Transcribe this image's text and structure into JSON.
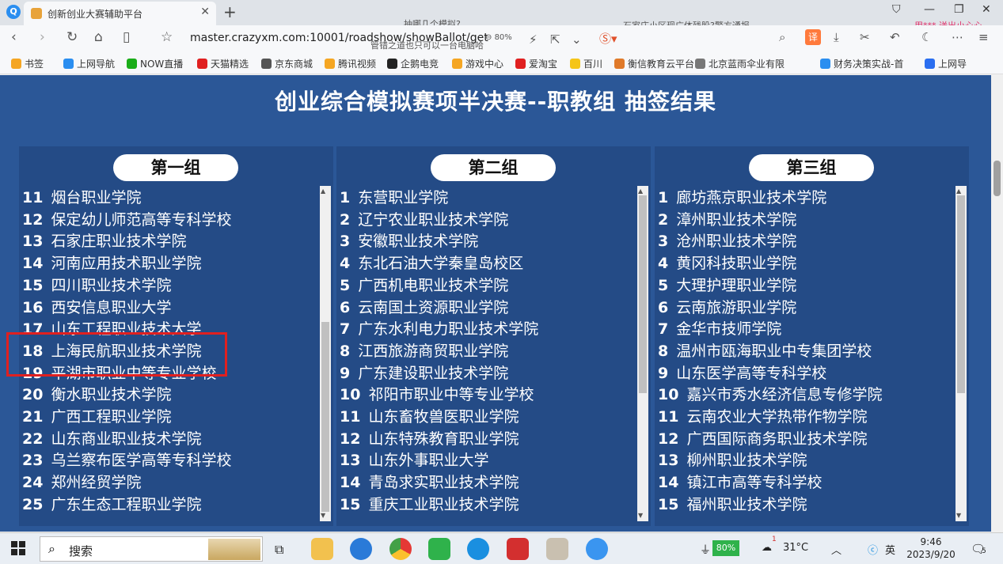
{
  "browser": {
    "tab_title": "创新创业大赛辅助平台",
    "url": "master.crazyxm.com:10001/roadshow/showBallot/get",
    "zoom": "80%",
    "promo": "用*** 送出小心心",
    "overlay_1": "抽哪几个模拟?",
    "overlay_2": "管错之道也只可以一台电脑哈",
    "overlay_3": "石家庄小区现广体残股?警方通报"
  },
  "bookmarks": [
    {
      "label": "书签",
      "color": "#f5a623"
    },
    {
      "label": "上网导航",
      "color": "#2a8ef0"
    },
    {
      "label": "NOW直播",
      "color": "#1aad19"
    },
    {
      "label": "天猫精选",
      "color": "#e02020"
    },
    {
      "label": "京东商城",
      "color": "#555555"
    },
    {
      "label": "腾讯视频",
      "color": "#f5a623"
    },
    {
      "label": "企鹅电竞",
      "color": "#222222"
    },
    {
      "label": "游戏中心",
      "color": "#f5a623"
    },
    {
      "label": "爱淘宝",
      "color": "#e02020"
    },
    {
      "label": "百川",
      "color": "#f5c518"
    },
    {
      "label": "衡信教育云平台",
      "color": "#e07a2a"
    },
    {
      "label": "北京蓝雨伞业有限",
      "color": "#777777"
    },
    {
      "label": "财务决策实战-首",
      "color": "#2a8ef0"
    },
    {
      "label": "上网导",
      "color": "#2a6ef0"
    }
  ],
  "page": {
    "title": "创业综合模拟赛项半决赛--职教组 抽签结果",
    "groups": [
      {
        "name": "第一组",
        "items": [
          {
            "num": "11",
            "name": "烟台职业学院"
          },
          {
            "num": "12",
            "name": "保定幼儿师范高等专科学校"
          },
          {
            "num": "13",
            "name": "石家庄职业技术学院"
          },
          {
            "num": "14",
            "name": "河南应用技术职业学院"
          },
          {
            "num": "15",
            "name": "四川职业技术学院"
          },
          {
            "num": "16",
            "name": "西安信息职业大学"
          },
          {
            "num": "17",
            "name": "山东工程职业技术大学"
          },
          {
            "num": "18",
            "name": "上海民航职业技术学院"
          },
          {
            "num": "19",
            "name": "平湖市职业中等专业学校"
          },
          {
            "num": "20",
            "name": "衡水职业技术学院"
          },
          {
            "num": "21",
            "name": "广西工程职业学院"
          },
          {
            "num": "22",
            "name": "山东商业职业技术学院"
          },
          {
            "num": "23",
            "name": "乌兰察布医学高等专科学校"
          },
          {
            "num": "24",
            "name": "郑州经贸学院"
          },
          {
            "num": "25",
            "name": "广东生态工程职业学院"
          }
        ]
      },
      {
        "name": "第二组",
        "items": [
          {
            "num": "1",
            "name": "东营职业学院"
          },
          {
            "num": "2",
            "name": "辽宁农业职业技术学院"
          },
          {
            "num": "3",
            "name": "安徽职业技术学院"
          },
          {
            "num": "4",
            "name": "东北石油大学秦皇岛校区"
          },
          {
            "num": "5",
            "name": "广西机电职业技术学院"
          },
          {
            "num": "6",
            "name": "云南国土资源职业学院"
          },
          {
            "num": "7",
            "name": "广东水利电力职业技术学院"
          },
          {
            "num": "8",
            "name": "江西旅游商贸职业学院"
          },
          {
            "num": "9",
            "name": "广东建设职业技术学院"
          },
          {
            "num": "10",
            "name": "祁阳市职业中等专业学校"
          },
          {
            "num": "11",
            "name": "山东畜牧兽医职业学院"
          },
          {
            "num": "12",
            "name": "山东特殊教育职业学院"
          },
          {
            "num": "13",
            "name": "山东外事职业大学"
          },
          {
            "num": "14",
            "name": "青岛求实职业技术学院"
          },
          {
            "num": "15",
            "name": "重庆工业职业技术学院"
          }
        ]
      },
      {
        "name": "第三组",
        "items": [
          {
            "num": "1",
            "name": "廊坊燕京职业技术学院"
          },
          {
            "num": "2",
            "name": "漳州职业技术学院"
          },
          {
            "num": "3",
            "name": "沧州职业技术学院"
          },
          {
            "num": "4",
            "name": "黄冈科技职业学院"
          },
          {
            "num": "5",
            "name": "大理护理职业学院"
          },
          {
            "num": "6",
            "name": "云南旅游职业学院"
          },
          {
            "num": "7",
            "name": "金华市技师学院"
          },
          {
            "num": "8",
            "name": "温州市瓯海职业中专集团学校"
          },
          {
            "num": "9",
            "name": "山东医学高等专科学校"
          },
          {
            "num": "10",
            "name": "嘉兴市秀水经济信息专修学院"
          },
          {
            "num": "11",
            "name": "云南农业大学热带作物学院"
          },
          {
            "num": "12",
            "name": "广西国际商务职业技术学院"
          },
          {
            "num": "13",
            "name": "柳州职业技术学院"
          },
          {
            "num": "14",
            "name": "镇江市高等专科学校"
          },
          {
            "num": "15",
            "name": "福州职业技术学院"
          }
        ]
      }
    ]
  },
  "taskbar": {
    "search_label": "搜索",
    "battery": "80%",
    "temperature": "31°C",
    "ime": "英",
    "time": "9:46",
    "date": "2023/9/20",
    "notifications": "5",
    "weather_badge": "1"
  }
}
